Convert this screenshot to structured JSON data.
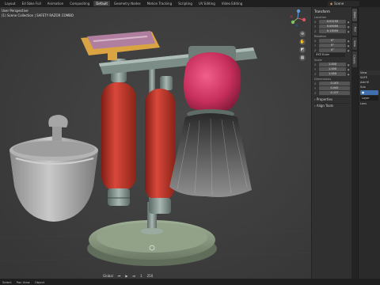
{
  "workspace_tabs": [
    {
      "label": "Layout",
      "active": false
    },
    {
      "label": "Ed Sbke Full",
      "active": false
    },
    {
      "label": "Animation",
      "active": false
    },
    {
      "label": "Compositing",
      "active": false
    },
    {
      "label": "Default",
      "active": true
    },
    {
      "label": "Geometry Nodes",
      "active": false
    },
    {
      "label": "Motion Tracking",
      "active": false
    },
    {
      "label": "Scripting",
      "active": false
    },
    {
      "label": "UV Editing",
      "active": false
    },
    {
      "label": "Video Editing",
      "active": false
    }
  ],
  "scene": {
    "label": "Scene"
  },
  "viewport": {
    "mode": "User Perspective",
    "collection": "(1) Scene Collection | SAFETY RAZOR COMBO"
  },
  "npanel": {
    "transform_title": "Transform",
    "location_label": "Location",
    "location": [
      {
        "axis": "X",
        "value": "0.01155"
      },
      {
        "axis": "Y",
        "value": "0.00000"
      },
      {
        "axis": "Z",
        "value": "0.13055"
      }
    ],
    "rotation_label": "Rotation",
    "rotation": [
      {
        "axis": "X",
        "value": "0°"
      },
      {
        "axis": "Y",
        "value": "0°"
      },
      {
        "axis": "Z",
        "value": "0°"
      }
    ],
    "rotation_mode": "XYZ Euler",
    "scale_label": "Scale",
    "scale": [
      {
        "axis": "X",
        "value": "1.000"
      },
      {
        "axis": "Y",
        "value": "1.000"
      },
      {
        "axis": "Z",
        "value": "1.000"
      }
    ],
    "dimensions_label": "Dimensions",
    "dimensions": [
      {
        "axis": "X",
        "value": "0.103"
      },
      {
        "axis": "Y",
        "value": "0.045"
      },
      {
        "axis": "Z",
        "value": "0.137"
      }
    ],
    "properties_label": "Properties",
    "align_tools_label": "Align Tools"
  },
  "vertical_tabs": [
    "Item",
    "Tool",
    "View",
    "Create"
  ],
  "right_column": {
    "header": "View",
    "items": [
      "SAFE",
      "Add M",
      "Sub",
      "Lens"
    ],
    "selected": "Layer"
  },
  "status": {
    "items": [
      "Select",
      "Pan View",
      "Object"
    ]
  },
  "timeline": {
    "playback": "Global",
    "frame_start": "1",
    "frame_end": "250"
  },
  "colors": {
    "handle_red": "#c0392b",
    "bowl": "#b9b9b9",
    "base": "#8a9a82",
    "brush_bulb": "#d43b6a",
    "razor_gold": "#d9a441",
    "razor_pink": "#b07fa0",
    "active_tab_bg": "#3d3d3d"
  }
}
